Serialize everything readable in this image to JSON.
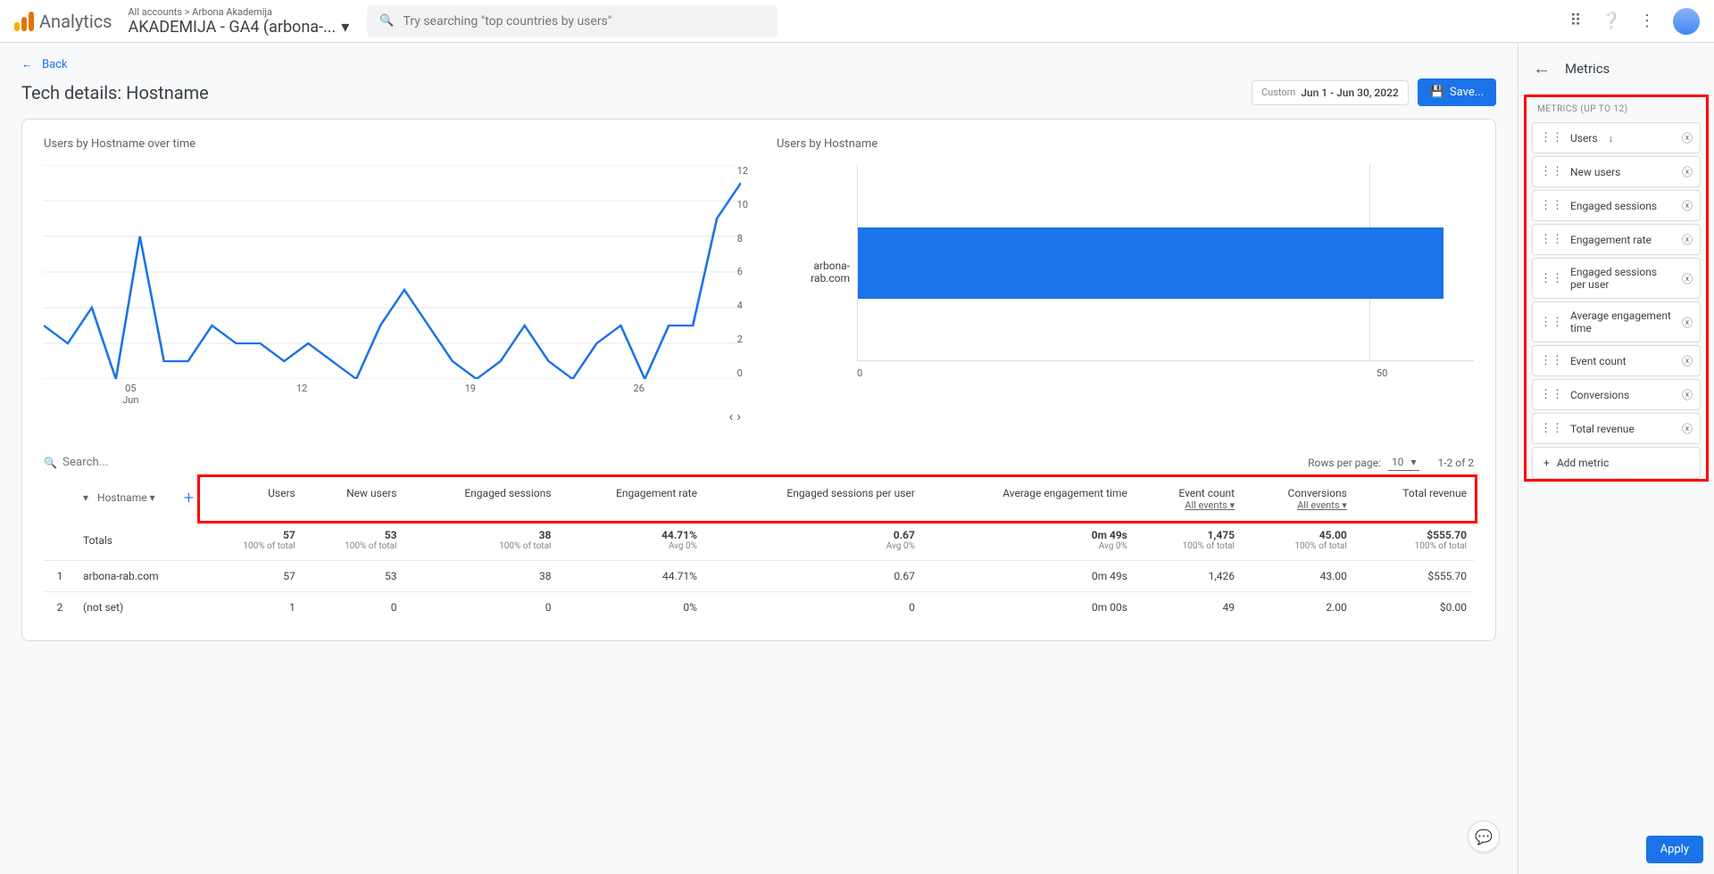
{
  "header": {
    "product": "Analytics",
    "breadcrumb": "All accounts > Arbona Akademija",
    "property": "AKADEMIJA - GA4 (arbona-...",
    "search_placeholder": "Try searching \"top countries by users\""
  },
  "page": {
    "back": "Back",
    "title": "Tech details: Hostname",
    "date_custom": "Custom",
    "date_range": "Jun 1 - Jun 30, 2022",
    "save": "Save..."
  },
  "chart_data": [
    {
      "type": "line",
      "title": "Users by Hostname over time",
      "x": [
        1,
        2,
        3,
        4,
        5,
        6,
        7,
        8,
        9,
        10,
        11,
        12,
        13,
        14,
        15,
        16,
        17,
        18,
        19,
        20,
        21,
        22,
        23,
        24,
        25,
        26,
        27,
        28,
        29,
        30
      ],
      "values": [
        3,
        2,
        4,
        0,
        8,
        1,
        1,
        3,
        2,
        2,
        1,
        2,
        1,
        0,
        3,
        5,
        3,
        1,
        0,
        1,
        3,
        1,
        0,
        2,
        3,
        0,
        3,
        3,
        9,
        11
      ],
      "y_ticks": [
        12,
        10,
        8,
        6,
        4,
        2,
        0
      ],
      "x_ticks": [
        "05",
        "12",
        "19",
        "26"
      ],
      "x_sublabel": "Jun",
      "ylim": [
        0,
        12
      ]
    },
    {
      "type": "bar",
      "title": "Users by Hostname",
      "categories": [
        "arbona-rab.com"
      ],
      "values": [
        57
      ],
      "x_ticks": [
        "0",
        "50"
      ],
      "xlim": [
        0,
        60
      ]
    }
  ],
  "table_controls": {
    "search_placeholder": "Search...",
    "rows_per_page_label": "Rows per page:",
    "rows_per_page": "10",
    "range": "1-2 of 2"
  },
  "table": {
    "dimension_label": "Hostname",
    "columns": [
      "Users",
      "New users",
      "Engaged sessions",
      "Engagement rate",
      "Engaged sessions per user",
      "Average engagement time",
      "Event count",
      "Conversions",
      "Total revenue"
    ],
    "sub_event_count": "All events",
    "sub_conversions": "All events",
    "totals_label": "Totals",
    "totals": {
      "users": {
        "v": "57",
        "s": "100% of total"
      },
      "new_users": {
        "v": "53",
        "s": "100% of total"
      },
      "engaged_sessions": {
        "v": "38",
        "s": "100% of total"
      },
      "engagement_rate": {
        "v": "44.71%",
        "s": "Avg 0%"
      },
      "esppu": {
        "v": "0.67",
        "s": "Avg 0%"
      },
      "aet": {
        "v": "0m 49s",
        "s": "Avg 0%"
      },
      "event_count": {
        "v": "1,475",
        "s": "100% of total"
      },
      "conversions": {
        "v": "45.00",
        "s": "100% of total"
      },
      "revenue": {
        "v": "$555.70",
        "s": "100% of total"
      }
    },
    "rows": [
      {
        "n": "1",
        "dim": "arbona-rab.com",
        "users": "57",
        "new_users": "53",
        "engaged_sessions": "38",
        "engagement_rate": "44.71%",
        "esppu": "0.67",
        "aet": "0m 49s",
        "event_count": "1,426",
        "conversions": "43.00",
        "revenue": "$555.70"
      },
      {
        "n": "2",
        "dim": "(not set)",
        "users": "1",
        "new_users": "0",
        "engaged_sessions": "0",
        "engagement_rate": "0%",
        "esppu": "0",
        "aet": "0m 00s",
        "event_count": "49",
        "conversions": "2.00",
        "revenue": "$0.00"
      }
    ]
  },
  "side": {
    "title": "Metrics",
    "section_label": "METRICS (UP TO 12)",
    "metrics": [
      "Users",
      "New users",
      "Engaged sessions",
      "Engagement rate",
      "Engaged sessions per user",
      "Average engagement time",
      "Event count",
      "Conversions",
      "Total revenue"
    ],
    "add_metric": "Add metric",
    "apply": "Apply"
  }
}
